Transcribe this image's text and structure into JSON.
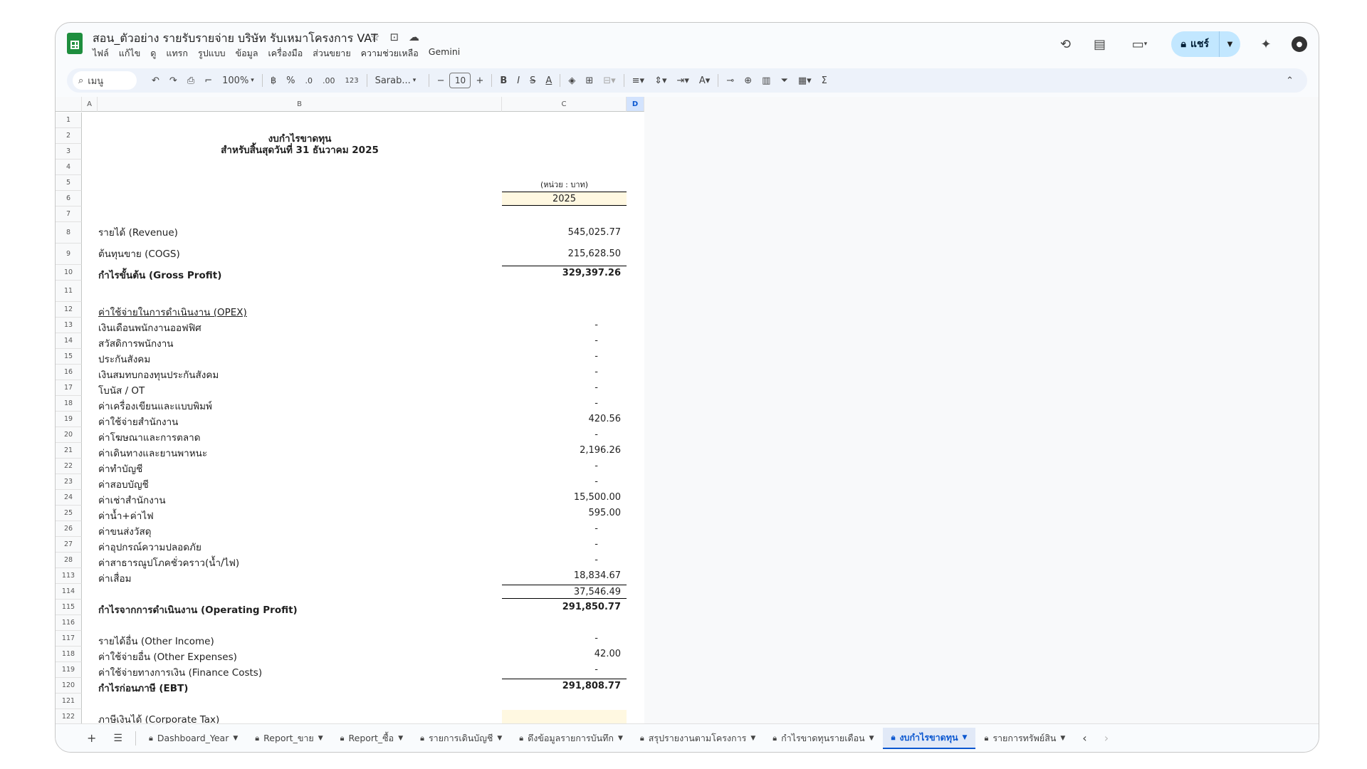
{
  "doc": {
    "title": "สอน_ตัวอย่าง รายรับรายจ่าย บริษัท รับเหมาโครงการ VAT",
    "menu": [
      "ไฟล์",
      "แก้ไข",
      "ดู",
      "แทรก",
      "รูปแบบ",
      "ข้อมูล",
      "เครื่องมือ",
      "ส่วนขยาย",
      "ความช่วยเหลือ",
      "Gemini"
    ],
    "share_label": "แชร์"
  },
  "toolbar": {
    "search": "เมนู",
    "zoom": "100%",
    "currency": "฿",
    "percent": "%",
    "dec_minus": ".0",
    "dec_plus": ".00",
    "format_123": "123",
    "font": "Sarab...",
    "font_size": "10"
  },
  "columns": [
    "A",
    "B",
    "C",
    "D"
  ],
  "sheet": {
    "title1": "งบกำไรขาดทุน",
    "title2": "สำหรับสิ้นสุดวันที่ 31 ธันวาคม 2025",
    "unit": "(หน่วย : บาท)",
    "year": "2025",
    "rows": [
      {
        "num": "1",
        "label": "",
        "value": ""
      },
      {
        "num": "2",
        "label": "",
        "value": ""
      },
      {
        "num": "3",
        "label": "",
        "value": ""
      },
      {
        "num": "4",
        "label": "",
        "value": ""
      },
      {
        "num": "5",
        "label": "",
        "value": ""
      },
      {
        "num": "6",
        "label": "",
        "value": ""
      },
      {
        "num": "7",
        "label": "",
        "value": ""
      },
      {
        "num": "8",
        "label": "รายได้ (Revenue)",
        "value": "545,025.77"
      },
      {
        "num": "9",
        "label": "ต้นทุนขาย (COGS)",
        "value": "215,628.50"
      },
      {
        "num": "10",
        "label": "กำไรขั้นต้น (Gross Profit)",
        "value": "329,397.26"
      },
      {
        "num": "11",
        "label": "",
        "value": ""
      },
      {
        "num": "12",
        "label": "ค่าใช้จ่ายในการดำเนินงาน (OPEX)",
        "value": ""
      },
      {
        "num": "13",
        "label": "เงินเดือนพนักงานออฟฟิศ",
        "value": "-"
      },
      {
        "num": "14",
        "label": "สวัสดิการพนักงาน",
        "value": "-"
      },
      {
        "num": "15",
        "label": "ประกันสังคม",
        "value": "-"
      },
      {
        "num": "16",
        "label": "เงินสมทบกองทุนประกันสังคม",
        "value": "-"
      },
      {
        "num": "17",
        "label": "โบนัส / OT",
        "value": "-"
      },
      {
        "num": "18",
        "label": "ค่าเครื่องเขียนและแบบพิมพ์",
        "value": "-"
      },
      {
        "num": "19",
        "label": "ค่าใช้จ่ายสำนักงาน",
        "value": "420.56"
      },
      {
        "num": "20",
        "label": "ค่าโฆษณาและการตลาด",
        "value": "-"
      },
      {
        "num": "21",
        "label": "ค่าเดินทางและยานพาหนะ",
        "value": "2,196.26"
      },
      {
        "num": "22",
        "label": "ค่าทำบัญชี",
        "value": "-"
      },
      {
        "num": "23",
        "label": "ค่าสอบบัญชี",
        "value": "-"
      },
      {
        "num": "24",
        "label": "ค่าเช่าสำนักงาน",
        "value": "15,500.00"
      },
      {
        "num": "25",
        "label": "ค่าน้ำ+ค่าไฟ",
        "value": "595.00"
      },
      {
        "num": "26",
        "label": "ค่าขนส่งวัสดุ",
        "value": "-"
      },
      {
        "num": "27",
        "label": "ค่าอุปกรณ์ความปลอดภัย",
        "value": "-"
      },
      {
        "num": "28",
        "label": "ค่าสาธารณูปโภคชั่วคราว(น้ำ/ไฟ)",
        "value": "-"
      },
      {
        "num": "113",
        "label": "ค่าเสื่อม",
        "value": "18,834.67"
      },
      {
        "num": "114",
        "label": "",
        "value": "37,546.49"
      },
      {
        "num": "115",
        "label": "กำไรจากการดำเนินงาน (Operating Profit)",
        "value": "291,850.77"
      },
      {
        "num": "116",
        "label": "",
        "value": ""
      },
      {
        "num": "117",
        "label": "รายได้อื่น (Other Income)",
        "value": "-"
      },
      {
        "num": "118",
        "label": "ค่าใช้จ่ายอื่น (Other Expenses)",
        "value": "42.00"
      },
      {
        "num": "119",
        "label": "ค่าใช้จ่ายทางการเงิน (Finance Costs)",
        "value": "-"
      },
      {
        "num": "120",
        "label": "กำไรก่อนภาษี (EBT)",
        "value": "291,808.77"
      },
      {
        "num": "121",
        "label": "",
        "value": ""
      },
      {
        "num": "122",
        "label": "ภาษีเงินได้ (Corporate Tax)",
        "value": ""
      }
    ]
  },
  "tabs": [
    {
      "label": "Dashboard_Year",
      "active": false
    },
    {
      "label": "Report_ขาย",
      "active": false
    },
    {
      "label": "Report_ซื้อ",
      "active": false
    },
    {
      "label": "รายการเดินบัญชี",
      "active": false
    },
    {
      "label": "ดึงข้อมูลรายการบันทึก",
      "active": false
    },
    {
      "label": "สรุปรายงานตามโครงการ",
      "active": false
    },
    {
      "label": "กำไรขาดทุนรายเดือน",
      "active": false
    },
    {
      "label": "งบกำไรขาดทุน",
      "active": true
    },
    {
      "label": "รายการทรัพย์สิน",
      "active": false
    }
  ]
}
